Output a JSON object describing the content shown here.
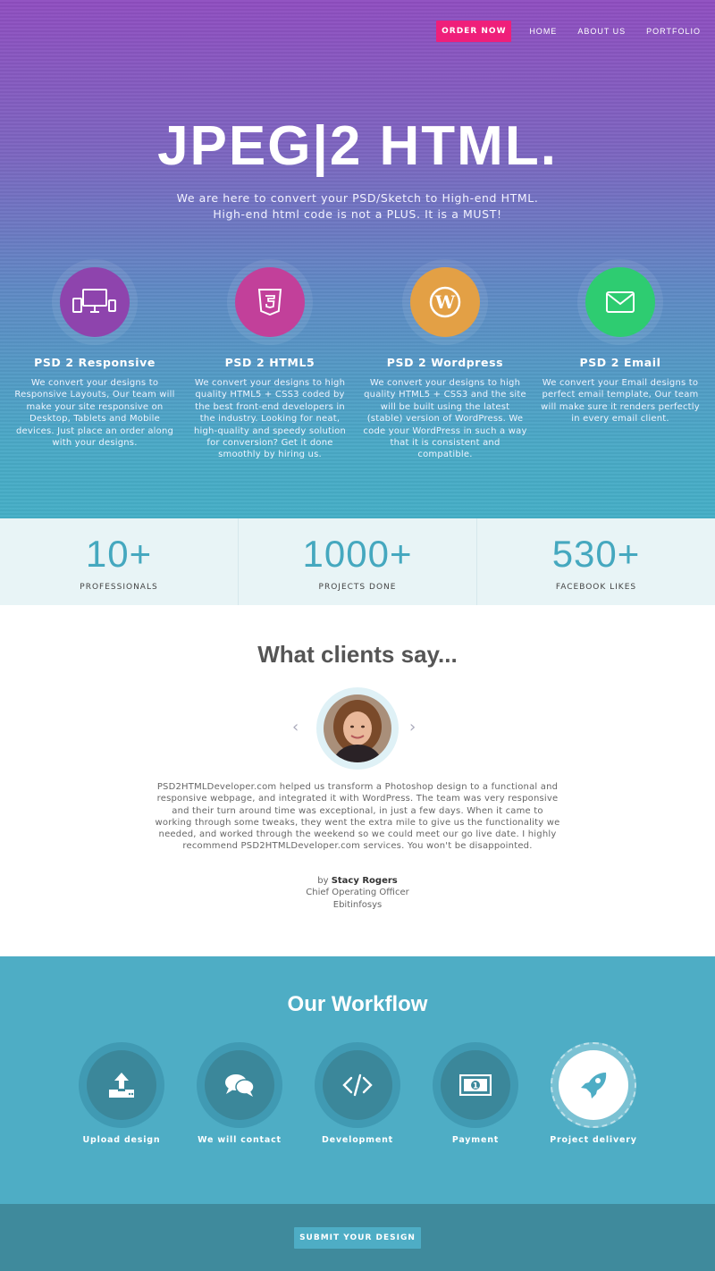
{
  "nav": {
    "order_label": "ORDER NOW",
    "links": [
      "HOME",
      "ABOUT US",
      "PORTFOLIO"
    ]
  },
  "hero": {
    "title": "JPEG|2 HTML.",
    "subtitle_line1": "We are here to convert your PSD/Sketch to High-end HTML.",
    "subtitle_line2": "High-end html code is not a PLUS. It is a MUST!"
  },
  "services": [
    {
      "title": "PSD 2 Responsive",
      "description": "We convert your designs to Responsive Layouts, Our team will make your site responsive on Desktop, Tablets and Mobile devices. Just place an order along with your designs.",
      "icon": "devices-icon",
      "color": "#8e44ad"
    },
    {
      "title": "PSD 2 HTML5",
      "description": "We convert your designs to high quality HTML5 + CSS3 coded by the best front-end developers in the industry. Looking for neat, high-quality and speedy solution for conversion? Get it done smoothly by hiring us.",
      "icon": "html5-icon",
      "color": "#c2409a"
    },
    {
      "title": "PSD 2 Wordpress",
      "description": "We convert your designs to high quality HTML5 + CSS3 and the site will be built using the latest (stable) version of WordPress. We code your WordPress in such a way that it is consistent and compatible.",
      "icon": "wordpress-icon",
      "color": "#e3a045"
    },
    {
      "title": "PSD 2 Email",
      "description": "We convert your Email designs to perfect email template, Our team will make sure it renders perfectly in every email client.",
      "icon": "envelope-icon",
      "color": "#2ecc71"
    }
  ],
  "stats": [
    {
      "value": "10+",
      "label": "PROFESSIONALS"
    },
    {
      "value": "1000+",
      "label": "PROJECTS DONE"
    },
    {
      "value": "530+",
      "label": "FACEBOOK LIKES"
    }
  ],
  "testimonial": {
    "title": "What clients say...",
    "quote": "PSD2HTMLDeveloper.com helped us transform a Photoshop design to a functional and responsive webpage, and integrated it with WordPress. The team was very responsive and their turn around time was exceptional, in just a few days. When it came to working through some tweaks, they went the extra mile to give us the functionality we needed, and worked through the weekend so we could meet our go live date. I highly recommend PSD2HTMLDeveloper.com services. You won't be disappointed.",
    "by_prefix": "by",
    "name": "Stacy Rogers",
    "role": "Chief Operating Officer",
    "company": "Ebitinfosys"
  },
  "workflow": {
    "title": "Our Workflow",
    "steps": [
      {
        "label": "Upload design",
        "icon": "upload-icon"
      },
      {
        "label": "We will contact",
        "icon": "chat-icon"
      },
      {
        "label": "Development",
        "icon": "code-icon"
      },
      {
        "label": "Payment",
        "icon": "banknote-icon"
      },
      {
        "label": "Project delivery",
        "icon": "rocket-icon"
      }
    ]
  },
  "footer": {
    "submit_label": "SUBMIT YOUR DESIGN"
  },
  "colors": {
    "accent_pink": "#ef1f7a",
    "teal": "#4eadc5",
    "teal_dark": "#3f8a9c",
    "stat_number": "#45a8bf"
  }
}
